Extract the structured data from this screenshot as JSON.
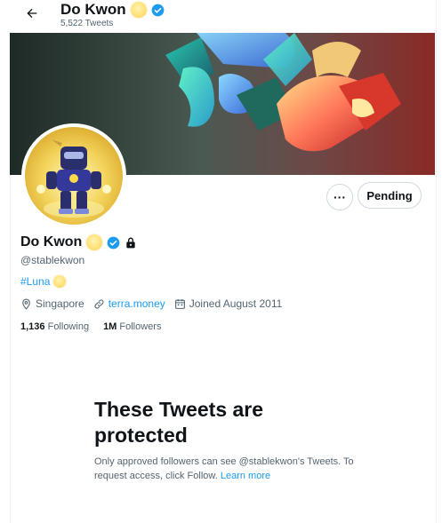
{
  "header": {
    "back_icon": "arrow-left-icon",
    "name": "Do Kwon",
    "tweet_count": "5,522 Tweets"
  },
  "profile": {
    "name": "Do Kwon",
    "handle": "@stablekwon",
    "bio_hashtag": "#Luna",
    "location": "Singapore",
    "website": "terra.money",
    "joined": "Joined August 2011",
    "following_count": "1,136",
    "following_label": "Following",
    "followers_count": "1M",
    "followers_label": "Followers"
  },
  "actions": {
    "more_label": "···",
    "pending_label": "Pending"
  },
  "protected": {
    "title": "These Tweets are protected",
    "description": "Only approved followers can see @stablekwon's Tweets. To request access, click Follow.",
    "learn_more": "Learn more"
  },
  "colors": {
    "accent": "#1d9bf0",
    "text": "#0f1419",
    "muted": "#536471",
    "border": "#cfd9de"
  }
}
